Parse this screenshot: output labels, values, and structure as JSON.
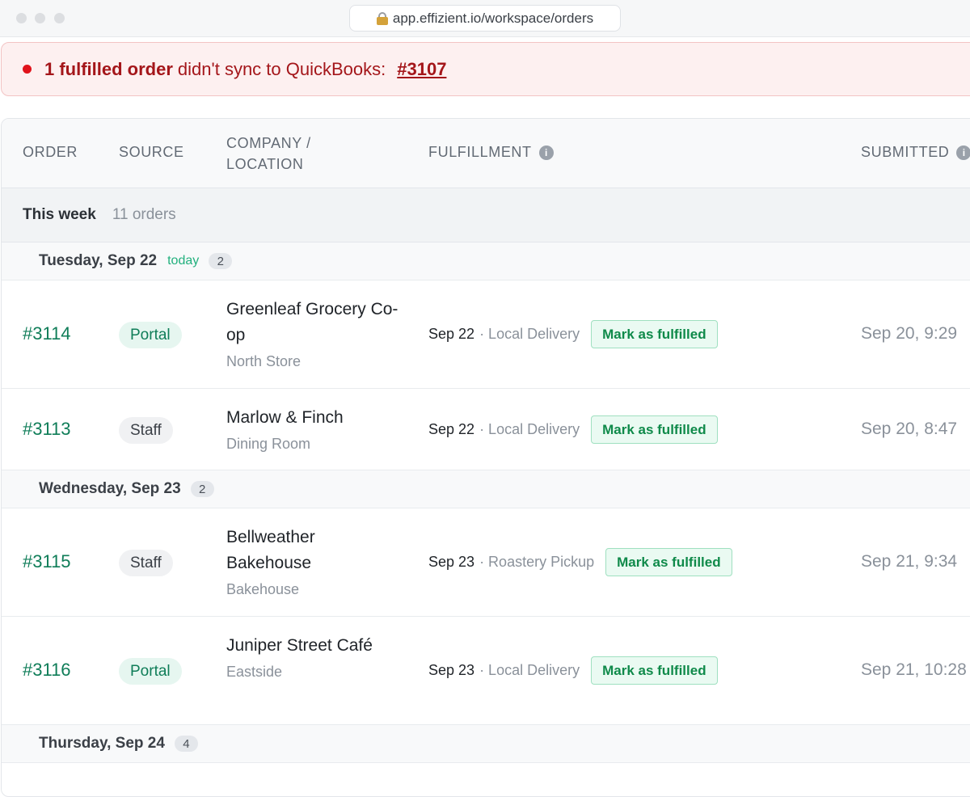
{
  "browser": {
    "url": "app.effizient.io/workspace/orders"
  },
  "alert": {
    "strong_text": "1 fulfilled order",
    "text": "didn't sync to QuickBooks:",
    "link": "#3107"
  },
  "table": {
    "columns": {
      "order": "ORDER",
      "source": "SOURCE",
      "company_line1": "COMPANY /",
      "company_line2": "LOCATION",
      "fulfillment": "FULFILLMENT",
      "submitted": "SUBMITTED"
    },
    "info_glyph": "i"
  },
  "week": {
    "title": "This week",
    "count": "11 orders"
  },
  "days": [
    {
      "label": "Tuesday, Sep 22",
      "today": "today",
      "count": "2"
    },
    {
      "label": "Wednesday, Sep 23",
      "today": "",
      "count": "2"
    },
    {
      "label": "Thursday, Sep 24",
      "today": "",
      "count": "4"
    }
  ],
  "orders": [
    {
      "id": "#3114",
      "source": "Portal",
      "company": "Greenleaf Grocery Co-op",
      "location": "North Store",
      "date": "Sep 22",
      "method": "· Local Delivery",
      "action": "Mark as fulfilled",
      "submitted": "Sep 20, 9:29"
    },
    {
      "id": "#3113",
      "source": "Staff",
      "company": "Marlow & Finch",
      "location": "Dining Room",
      "date": "Sep 22",
      "method": "· Local Delivery",
      "action": "Mark as fulfilled",
      "submitted": "Sep 20, 8:47"
    },
    {
      "id": "#3115",
      "source": "Staff",
      "company": "Bellweather Bakehouse",
      "location": "Bakehouse",
      "date": "Sep 23",
      "method": "· Roastery Pickup",
      "action": "Mark as fulfilled",
      "submitted": "Sep 21, 9:34"
    },
    {
      "id": "#3116",
      "source": "Portal",
      "company": "Juniper Street Café",
      "location": "Eastside",
      "date": "Sep 23",
      "method": "· Local Delivery",
      "action": "Mark as fulfilled",
      "submitted": "Sep 21, 10:28"
    }
  ],
  "colors": {
    "accent_green": "#0f7d58",
    "alert_red": "#a4161a",
    "today_green": "#22b07d"
  }
}
